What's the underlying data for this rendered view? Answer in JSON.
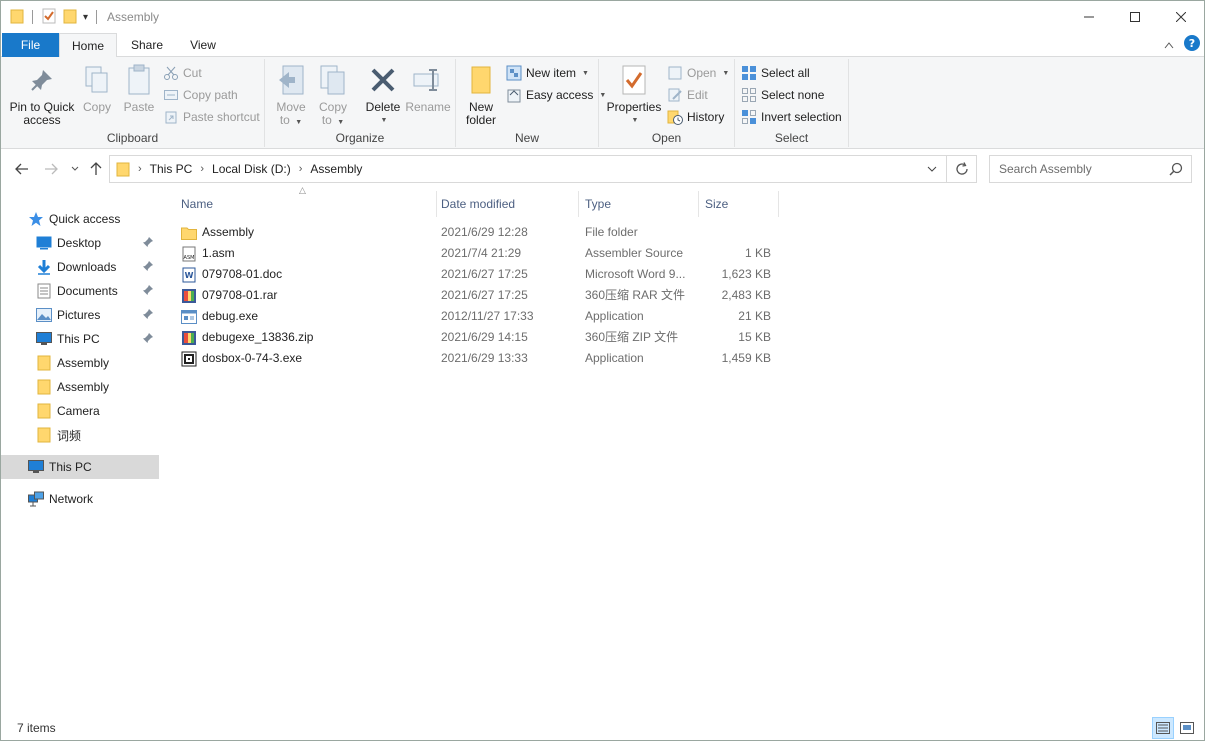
{
  "window": {
    "title": "Assembly"
  },
  "ribbon_tabs": {
    "file": "File",
    "home": "Home",
    "share": "Share",
    "view": "View"
  },
  "clipboard": {
    "pin_line1": "Pin to Quick",
    "pin_line2": "access",
    "copy": "Copy",
    "paste": "Paste",
    "cut": "Cut",
    "copy_path": "Copy path",
    "paste_shortcut": "Paste shortcut",
    "label": "Clipboard"
  },
  "organize": {
    "move_line1": "Move",
    "move_line2": "to",
    "copy_line1": "Copy",
    "copy_line2": "to",
    "delete": "Delete",
    "rename": "Rename",
    "label": "Organize"
  },
  "new_group": {
    "new_folder_line1": "New",
    "new_folder_line2": "folder",
    "new_item": "New item",
    "easy_access": "Easy access",
    "label": "New"
  },
  "open_group": {
    "properties": "Properties",
    "open": "Open",
    "edit": "Edit",
    "history": "History",
    "label": "Open"
  },
  "select_group": {
    "select_all": "Select all",
    "select_none": "Select none",
    "invert_selection": "Invert selection",
    "label": "Select"
  },
  "address": {
    "crumbs": [
      "This PC",
      "Local Disk (D:)",
      "Assembly"
    ],
    "search_placeholder": "Search Assembly"
  },
  "nav": {
    "quick_access": "Quick access",
    "items": [
      {
        "label": "Desktop",
        "icon": "desktop-icon",
        "pinned": true
      },
      {
        "label": "Downloads",
        "icon": "downloads-icon",
        "pinned": true
      },
      {
        "label": "Documents",
        "icon": "documents-icon",
        "pinned": true
      },
      {
        "label": "Pictures",
        "icon": "pictures-icon",
        "pinned": true
      },
      {
        "label": "This PC",
        "icon": "this-pc-icon",
        "pinned": true
      },
      {
        "label": "Assembly",
        "icon": "folder-icon",
        "pinned": false
      },
      {
        "label": "Assembly",
        "icon": "folder-icon",
        "pinned": false
      },
      {
        "label": "Camera",
        "icon": "folder-icon",
        "pinned": false
      },
      {
        "label": "词频",
        "icon": "folder-icon",
        "pinned": false
      }
    ],
    "this_pc": "This PC",
    "network": "Network"
  },
  "columns": {
    "name": "Name",
    "date": "Date modified",
    "type": "Type",
    "size": "Size"
  },
  "files": [
    {
      "name": "Assembly",
      "date": "2021/6/29 12:28",
      "type": "File folder",
      "size": "",
      "icon": "folder-icon"
    },
    {
      "name": "1.asm",
      "date": "2021/7/4 21:29",
      "type": "Assembler Source",
      "size": "1 KB",
      "icon": "asm-file-icon"
    },
    {
      "name": "079708-01.doc",
      "date": "2021/6/27 17:25",
      "type": "Microsoft Word 9...",
      "size": "1,623 KB",
      "icon": "word-doc-icon"
    },
    {
      "name": "079708-01.rar",
      "date": "2021/6/27 17:25",
      "type": "360压缩 RAR 文件",
      "size": "2,483 KB",
      "icon": "rar-archive-icon"
    },
    {
      "name": "debug.exe",
      "date": "2012/11/27 17:33",
      "type": "Application",
      "size": "21 KB",
      "icon": "exe-app-icon"
    },
    {
      "name": "debugexe_13836.zip",
      "date": "2021/6/29 14:15",
      "type": "360压缩 ZIP 文件",
      "size": "15 KB",
      "icon": "zip-archive-icon"
    },
    {
      "name": "dosbox-0-74-3.exe",
      "date": "2021/6/29 13:33",
      "type": "Application",
      "size": "1,459 KB",
      "icon": "dosbox-app-icon"
    }
  ],
  "status": {
    "count": "7 items"
  },
  "colors": {
    "file_tab": "#1979ca",
    "folder": "#ffd76e",
    "selected": "#d9d9d9",
    "column_header": "#4d6082"
  }
}
